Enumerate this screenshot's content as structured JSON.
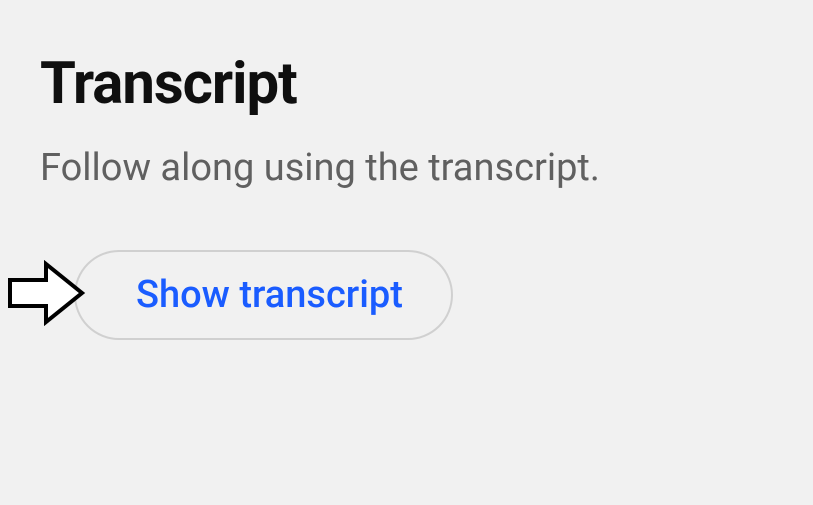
{
  "heading": "Transcript",
  "description": "Follow along using the transcript.",
  "button_label": "Show transcript"
}
